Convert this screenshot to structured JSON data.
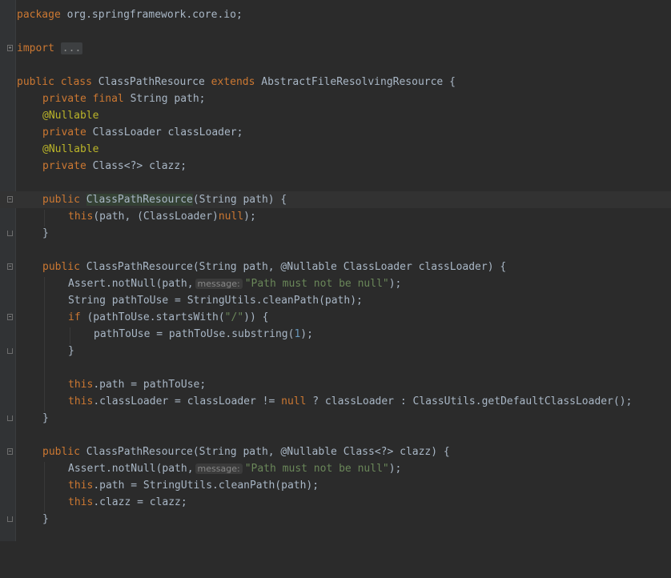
{
  "editor": {
    "background": "#2b2b2b",
    "gutter_background": "#313335",
    "colors": {
      "keyword": "#cc7832",
      "plain": "#a9b7c6",
      "annotation": "#bbb529",
      "string": "#6a8759",
      "number": "#6897bb",
      "hint": "#888888"
    },
    "lines": {
      "l1": {
        "kw": "package",
        "rest": " org.springframework.core.io;"
      },
      "l3": {
        "kw": "import",
        "folded": "..."
      },
      "l5": {
        "kw1": "public",
        "kw2": "class",
        "name": " ClassPathResource ",
        "kw3": "extends",
        "rest": " AbstractFileResolvingResource {"
      },
      "l6": {
        "kw1": "private",
        "kw2": "final",
        "rest": " String path;"
      },
      "l7": {
        "ann": "@Nullable"
      },
      "l8": {
        "kw": "private",
        "rest": " ClassLoader classLoader;"
      },
      "l9": {
        "ann": "@Nullable"
      },
      "l10": {
        "kw": "private",
        "rest": " Class<?> clazz;"
      },
      "l12": {
        "kw": "public",
        "ctor": "ClassPathResource",
        "rest": "(String path) {"
      },
      "l13": {
        "kw": "this",
        "mid": "(path, (ClassLoader)",
        "kw2": "null",
        "rest": ");"
      },
      "l14": {
        "rest": "}"
      },
      "l16": {
        "kw": "public",
        "rest": " ClassPathResource(String path, @Nullable ClassLoader classLoader) {"
      },
      "l17": {
        "pre": "Assert.notNull(path,",
        "hint": "message:",
        "str": "\"Path must not be null\"",
        "rest": ");"
      },
      "l18": {
        "rest": "String pathToUse = StringUtils.cleanPath(path);"
      },
      "l19": {
        "kw": "if",
        "mid": " (pathToUse.startsWith(",
        "str": "\"/\"",
        "rest": ")) {"
      },
      "l20": {
        "pre": "pathToUse = pathToUse.substring(",
        "num": "1",
        "rest": ");"
      },
      "l21": {
        "rest": "}"
      },
      "l23": {
        "kw": "this",
        "rest": ".path = pathToUse;"
      },
      "l24": {
        "kw": "this",
        "mid": ".classLoader = classLoader != ",
        "kw2": "null",
        "rest": " ? classLoader : ClassUtils.getDefaultClassLoader();"
      },
      "l25": {
        "rest": "}"
      },
      "l27": {
        "kw": "public",
        "rest": " ClassPathResource(String path, @Nullable Class<?> clazz) {"
      },
      "l28": {
        "pre": "Assert.notNull(path,",
        "hint": "message:",
        "str": "\"Path must not be null\"",
        "rest": ");"
      },
      "l29": {
        "kw": "this",
        "rest": ".path = StringUtils.cleanPath(path);"
      },
      "l30": {
        "kw": "this",
        "rest": ".clazz = clazz;"
      },
      "l31": {
        "rest": "}"
      }
    }
  }
}
